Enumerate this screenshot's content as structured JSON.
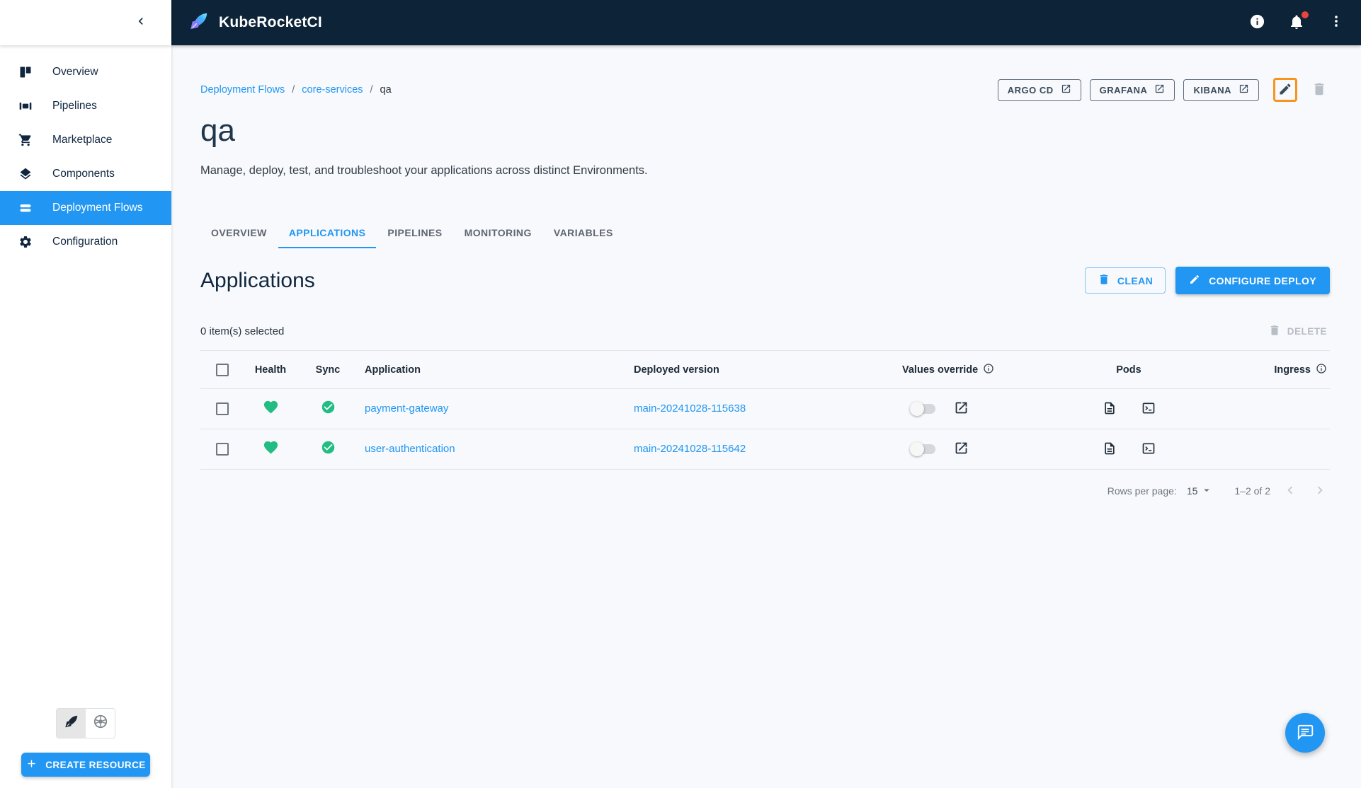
{
  "colors": {
    "accent": "#2196f3",
    "success_green": "#21bd82",
    "header_bg": "#0d2438",
    "highlight_orange": "#f7941e",
    "badge_red": "#e8453c"
  },
  "topbar": {
    "title": "KubeRocketCI",
    "icons": [
      "info-icon",
      "notifications-icon",
      "kebab-menu-icon"
    ],
    "has_notification_badge": true
  },
  "sidebar": {
    "collapse_icon": "chevron-left-icon",
    "items": [
      {
        "label": "Overview",
        "icon": "overview-icon",
        "active": false
      },
      {
        "label": "Pipelines",
        "icon": "pipelines-icon",
        "active": false
      },
      {
        "label": "Marketplace",
        "icon": "marketplace-icon",
        "active": false
      },
      {
        "label": "Components",
        "icon": "components-icon",
        "active": false
      },
      {
        "label": "Deployment Flows",
        "icon": "deployment-flows-icon",
        "active": true
      },
      {
        "label": "Configuration",
        "icon": "configuration-icon",
        "active": false
      }
    ],
    "footer": {
      "view_toggle_icons": [
        "rocket-icon",
        "kubernetes-icon"
      ],
      "selected_view": 0,
      "create_resource_label": "CREATE RESOURCE"
    }
  },
  "breadcrumb": {
    "links": [
      "Deployment Flows",
      "core-services"
    ],
    "separator": "/",
    "current": "qa"
  },
  "page": {
    "title": "qa",
    "description": "Manage, deploy, test, and troubleshoot your applications across distinct Environments.",
    "quick_links": [
      "ARGO CD",
      "GRAFANA",
      "KIBANA"
    ]
  },
  "tabs": {
    "items": [
      "OVERVIEW",
      "APPLICATIONS",
      "PIPELINES",
      "MONITORING",
      "VARIABLES"
    ],
    "active_index": 1
  },
  "applications": {
    "heading": "Applications",
    "clean_label": "CLEAN",
    "configure_deploy_label": "CONFIGURE DEPLOY",
    "selected_text": "0 item(s) selected",
    "delete_label": "DELETE",
    "table": {
      "headers": {
        "health": "Health",
        "sync": "Sync",
        "application": "Application",
        "deployed_version": "Deployed version",
        "values_override": "Values override",
        "pods": "Pods",
        "ingress": "Ingress"
      },
      "rows": [
        {
          "application": "payment-gateway",
          "deployed_version": "main-20241028-115638",
          "health": "healthy",
          "sync": "synced",
          "values_override": false
        },
        {
          "application": "user-authentication",
          "deployed_version": "main-20241028-115642",
          "health": "healthy",
          "sync": "synced",
          "values_override": false
        }
      ]
    },
    "pagination": {
      "rows_per_page_label": "Rows per page:",
      "rows_per_page": "15",
      "range_text": "1–2 of 2"
    }
  }
}
